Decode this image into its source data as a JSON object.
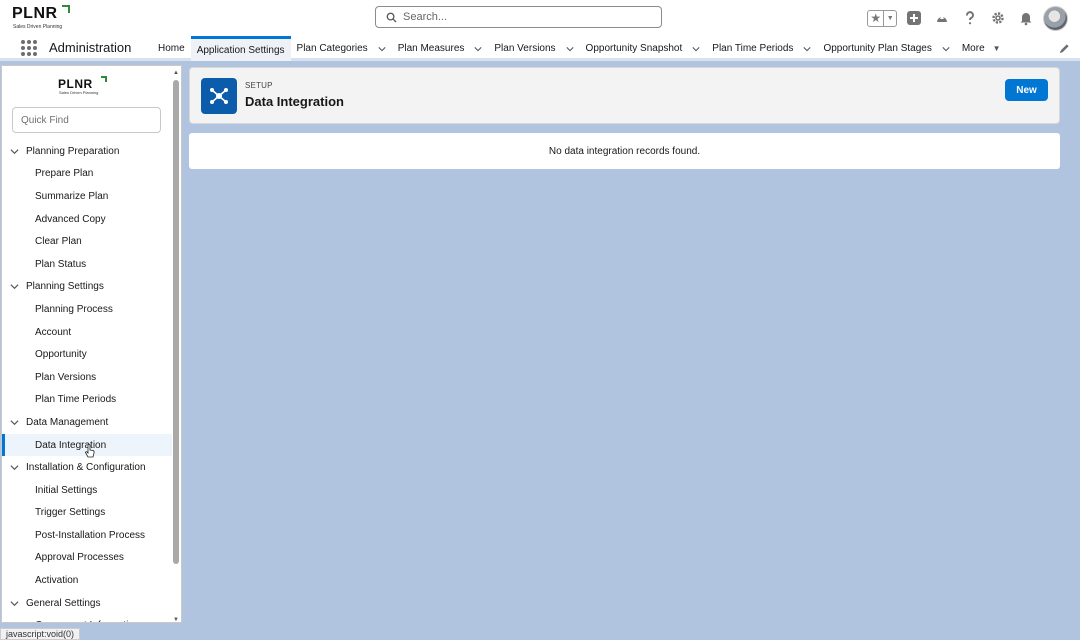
{
  "brand": {
    "logo": "PLNR",
    "tagline": "Sales Driven Planning",
    "accent": "#2e8b3a"
  },
  "search": {
    "placeholder": "Search..."
  },
  "header_icons": [
    "favorites-star-icon",
    "add-icon",
    "trailhead-icon",
    "help-icon",
    "setup-gear-icon",
    "notification-bell-icon",
    "avatar"
  ],
  "app": {
    "name": "Administration"
  },
  "nav": {
    "items": [
      {
        "label": "Home",
        "dropdown": false
      },
      {
        "label": "Application Settings",
        "dropdown": false,
        "active": true
      },
      {
        "label": "Plan Categories",
        "dropdown": true
      },
      {
        "label": "Plan Measures",
        "dropdown": true
      },
      {
        "label": "Plan Versions",
        "dropdown": true
      },
      {
        "label": "Opportunity Snapshot",
        "dropdown": true
      },
      {
        "label": "Plan Time Periods",
        "dropdown": true
      },
      {
        "label": "Opportunity Plan Stages",
        "dropdown": true
      }
    ],
    "more": "More"
  },
  "sidebar": {
    "quick_find_placeholder": "Quick Find",
    "sections": [
      {
        "label": "Planning Preparation",
        "items": [
          "Prepare Plan",
          "Summarize Plan",
          "Advanced Copy",
          "Clear Plan",
          "Plan Status"
        ]
      },
      {
        "label": "Planning Settings",
        "items": [
          "Planning Process",
          "Account",
          "Opportunity",
          "Plan Versions",
          "Plan Time Periods"
        ]
      },
      {
        "label": "Data Management",
        "items": [
          "Data Integration"
        ]
      },
      {
        "label": "Installation & Configuration",
        "items": [
          "Initial Settings",
          "Trigger Settings",
          "Post-Installation Process",
          "Approval Processes",
          "Activation"
        ]
      },
      {
        "label": "General Settings",
        "items": [
          "Component Information"
        ]
      }
    ],
    "selected": "Data Integration"
  },
  "page": {
    "eyebrow": "SETUP",
    "title": "Data Integration",
    "new_button": "New",
    "empty_message": "No data integration records found."
  },
  "status_bar": "javascript:void(0)",
  "colors": {
    "brand_blue": "#0176d3",
    "icon_blue": "#0b5cab",
    "background": "#b0c4df"
  }
}
